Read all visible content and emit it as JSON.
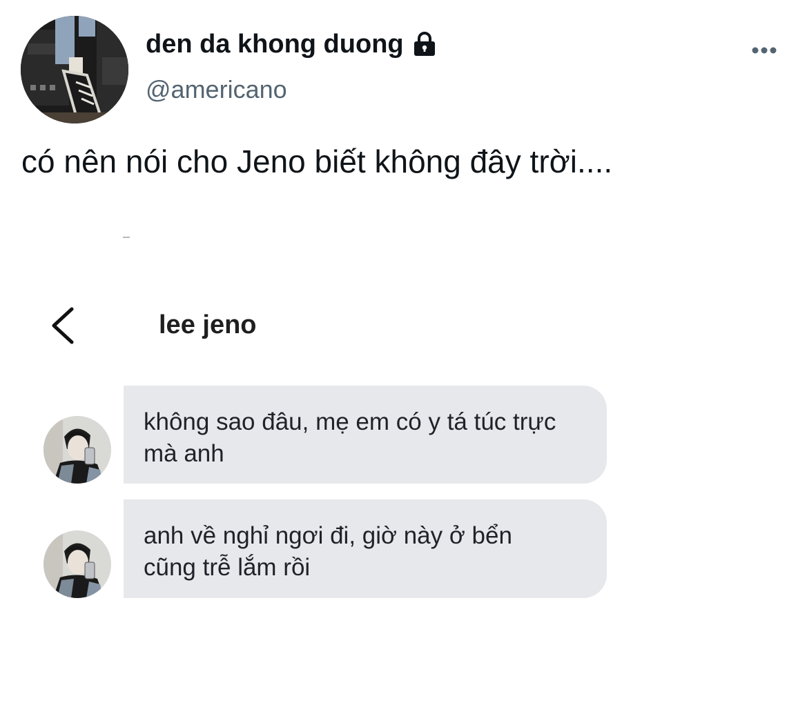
{
  "post": {
    "author": {
      "display_name": "den da khong duong",
      "handle": "@americano",
      "protected_icon": "lock-icon",
      "avatar": "sneakers-photo"
    },
    "more_icon": "more-horizontal-icon",
    "text": "có nên nói cho Jeno biết không đây trời...."
  },
  "dm_screenshot": {
    "back_icon": "chevron-left-icon",
    "title": "lee jeno",
    "messages": [
      {
        "text": "không sao đâu, mẹ em có y tá túc trực mà anh"
      },
      {
        "text": "anh về nghỉ ngơi đi, giờ này ở bển cũng trễ lắm rồi"
      }
    ]
  },
  "colors": {
    "text_primary": "#0f1419",
    "text_secondary": "#536471",
    "bubble_bg": "#e6e8ec",
    "background": "#ffffff"
  }
}
